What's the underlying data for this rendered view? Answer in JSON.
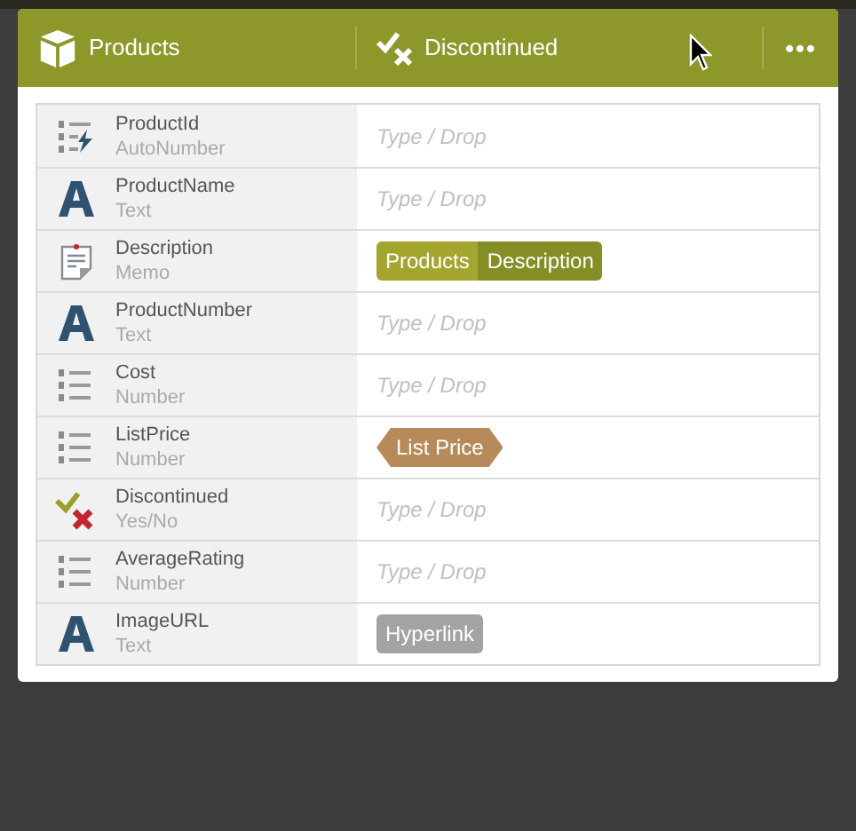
{
  "header": {
    "title": "Products",
    "filter": "Discontinued",
    "menu": "•••"
  },
  "fields": [
    {
      "name": "ProductId",
      "type": "AutoNumber",
      "kind": "autonumber",
      "value": {
        "kind": "placeholder",
        "placeholder": "Type / Drop"
      }
    },
    {
      "name": "ProductName",
      "type": "Text",
      "kind": "text",
      "value": {
        "kind": "placeholder",
        "placeholder": "Type / Drop"
      }
    },
    {
      "name": "Description",
      "type": "Memo",
      "kind": "memo",
      "value": {
        "kind": "pair",
        "parts": [
          "Products",
          "Description"
        ]
      }
    },
    {
      "name": "ProductNumber",
      "type": "Text",
      "kind": "text",
      "value": {
        "kind": "placeholder",
        "placeholder": "Type / Drop"
      }
    },
    {
      "name": "Cost",
      "type": "Number",
      "kind": "number",
      "value": {
        "kind": "placeholder",
        "placeholder": "Type / Drop"
      }
    },
    {
      "name": "ListPrice",
      "type": "Number",
      "kind": "number",
      "value": {
        "kind": "tag",
        "text": "List Price"
      }
    },
    {
      "name": "Discontinued",
      "type": "Yes/No",
      "kind": "yesno",
      "value": {
        "kind": "placeholder",
        "placeholder": "Type / Drop"
      }
    },
    {
      "name": "AverageRating",
      "type": "Number",
      "kind": "number",
      "value": {
        "kind": "placeholder",
        "placeholder": "Type / Drop"
      }
    },
    {
      "name": "ImageURL",
      "type": "Text",
      "kind": "text",
      "value": {
        "kind": "chip",
        "text": "Hyperlink"
      }
    }
  ]
}
